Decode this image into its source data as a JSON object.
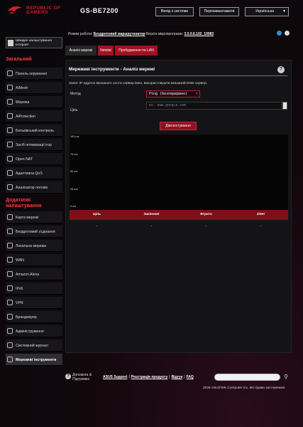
{
  "header": {
    "brand_line1": "REPUBLIC OF",
    "brand_line2": "GAMERS",
    "model": "GS-BE7200",
    "logout_label": "Вихід з системи",
    "reboot_label": "Перезавантажити",
    "language_label": "Українська"
  },
  "status": {
    "mode_label": "Режим роботи:",
    "mode_value": "Бездротовий маршрутизатор",
    "firmware_label": "Версія мікропрограми:",
    "firmware_value": "3.0.0.6.102_10083",
    "icons": [
      "network-status-icon",
      "settings-icon"
    ]
  },
  "sidebar": {
    "quick_setup": "Швидке налаштування Інтернет",
    "general_title": "Загальний",
    "general_items": [
      {
        "label": "Панель керування",
        "icon": "dashboard-icon"
      },
      {
        "label": "AiMesh",
        "icon": "aimesh-icon"
      },
      {
        "label": "Мережа",
        "icon": "network-icon"
      },
      {
        "label": "AiProtection",
        "icon": "aiprotection-icon"
      },
      {
        "label": "Батьківський контроль",
        "icon": "parental-control-icon"
      },
      {
        "label": "Засіб оптимізації ігор",
        "icon": "game-boost-icon"
      },
      {
        "label": "Open NAT",
        "icon": "open-nat-icon"
      },
      {
        "label": "Адаптивна QoS",
        "icon": "qos-icon"
      },
      {
        "label": "Аналізатор потоків",
        "icon": "traffic-analyzer-icon"
      }
    ],
    "advanced_title_line1": "Додаткові",
    "advanced_title_line2": "налаштування",
    "advanced_items": [
      {
        "label": "Карта мережі",
        "icon": "network-map-icon"
      },
      {
        "label": "Бездротовий з'єднання",
        "icon": "wireless-icon"
      },
      {
        "label": "Локальна мережа",
        "icon": "lan-icon"
      },
      {
        "label": "WAN",
        "icon": "wan-icon"
      },
      {
        "label": "Amazon Alexa",
        "icon": "alexa-icon"
      },
      {
        "label": "IPv6",
        "icon": "ipv6-icon"
      },
      {
        "label": "VPN",
        "icon": "vpn-icon"
      },
      {
        "label": "Брандмауер",
        "icon": "firewall-icon"
      },
      {
        "label": "Адміністрування",
        "icon": "administration-icon"
      },
      {
        "label": "Системний журнал",
        "icon": "system-log-icon"
      },
      {
        "label": "Мережеві інструменти",
        "icon": "network-tools-icon"
      }
    ]
  },
  "tabs": [
    {
      "label": "Аналіз мережі",
      "active": true
    },
    {
      "label": "Netstat",
      "active": false
    },
    {
      "label": "Пробудження по LAN",
      "active": false
    }
  ],
  "panel": {
    "title": "Мережеві інструменти - Аналіз мережі",
    "description": "Запит IP-адреси вказаного хоста сервер імен, використовуючи вказаний DNS-сервер.",
    "method_label": "Метод",
    "method_value": "Ping (безперервно)",
    "target_label": "Ціль",
    "target_placeholder": "ex: www.google.com",
    "diagnose_label": "Діагностування"
  },
  "chart_data": {
    "type": "line",
    "title": "",
    "xlabel": "",
    "ylabel": "",
    "ylim": [
      0,
      100
    ],
    "y_ticks": [
      "100 ms",
      "75 ms",
      "50 ms",
      "25 ms",
      "0 ms"
    ],
    "series": [],
    "grid": false
  },
  "results_table": {
    "columns": [
      "Ціль",
      "Закінчені",
      "Втрата",
      "Jitter"
    ],
    "rows": [
      [
        "-",
        "-",
        "-",
        "-"
      ]
    ]
  },
  "footer": {
    "help_line1": "Допомога &",
    "help_line2": "Підтримка",
    "link_support": "ASUS Support",
    "link_register": "Реєстрація продукту",
    "link_feedback": "Відгук",
    "link_faq": "FAQ",
    "copyright": "2026 ASUSTeK Computer Inc. Всі права застережені."
  },
  "colors": {
    "accent_red": "#d81a2a",
    "tab_red": "#a01222",
    "table_head": "#7c1018"
  }
}
